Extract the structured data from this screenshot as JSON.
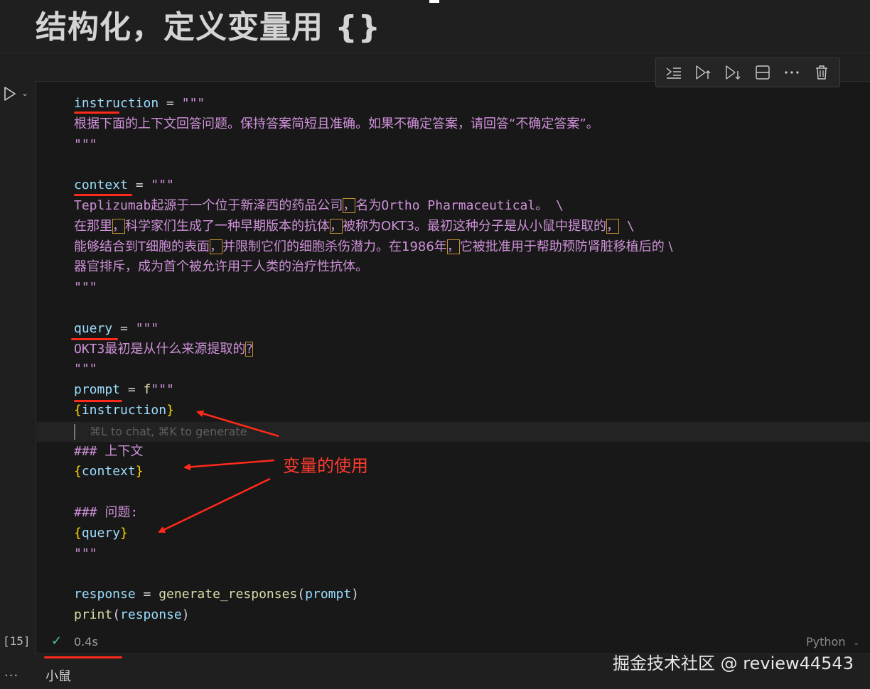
{
  "heading": "结构化，定义变量用 {}",
  "cell": {
    "code_lines": [
      [
        {
          "t": "instruction",
          "c": "var"
        },
        {
          "t": " = ",
          "c": "op"
        },
        {
          "t": "\"\"\"",
          "c": "str"
        }
      ],
      [
        {
          "t": "根据下面的上下文回答问题。保持答案简短且准确。如果不确定答案，请回答“不确定答案”。",
          "c": "str cn"
        }
      ],
      [
        {
          "t": "\"\"\"",
          "c": "str"
        }
      ],
      [],
      [
        {
          "t": "context",
          "c": "var"
        },
        {
          "t": " = ",
          "c": "op"
        },
        {
          "t": "\"\"\"",
          "c": "str"
        }
      ],
      [
        {
          "t": "Teplizumab起源于一个位于新泽西的药品公司",
          "c": "str"
        },
        {
          "t": "，",
          "c": "str box"
        },
        {
          "t": "名为Ortho Pharmaceutical。 \\",
          "c": "str"
        }
      ],
      [
        {
          "t": "在那里",
          "c": "str cn"
        },
        {
          "t": "，",
          "c": "str box"
        },
        {
          "t": "科学家们生成了一种早期版本的抗体",
          "c": "str cn"
        },
        {
          "t": "，",
          "c": "str box"
        },
        {
          "t": "被称为OKT3。最初这种分子是从小鼠中提取的",
          "c": "str cn"
        },
        {
          "t": "，",
          "c": "str box"
        },
        {
          "t": " \\",
          "c": "str"
        }
      ],
      [
        {
          "t": "能够结合到T细胞的表面",
          "c": "str cn"
        },
        {
          "t": "，",
          "c": "str box"
        },
        {
          "t": "并限制它们的细胞杀伤潜力。在1986年",
          "c": "str cn"
        },
        {
          "t": "，",
          "c": "str box"
        },
        {
          "t": "它被批准用于帮助预防肾脏移植后的 \\",
          "c": "str cn"
        }
      ],
      [
        {
          "t": "器官排斥，成为首个被允许用于人类的治疗性抗体。",
          "c": "str cn"
        }
      ],
      [
        {
          "t": "\"\"\"",
          "c": "str"
        }
      ],
      [],
      [
        {
          "t": "query",
          "c": "var"
        },
        {
          "t": " = ",
          "c": "op"
        },
        {
          "t": "\"\"\"",
          "c": "str"
        }
      ],
      [
        {
          "t": "OKT3最初是从什么来源提取的",
          "c": "str"
        },
        {
          "t": "?",
          "c": "str box"
        }
      ],
      [
        {
          "t": "\"\"\"",
          "c": "str"
        }
      ],
      [
        {
          "t": "prompt",
          "c": "var"
        },
        {
          "t": " = ",
          "c": "op"
        },
        {
          "t": "f",
          "c": "fun"
        },
        {
          "t": "\"\"\"",
          "c": "str"
        }
      ],
      [
        {
          "t": "{",
          "c": "brace"
        },
        {
          "t": "instruction",
          "c": "var"
        },
        {
          "t": "}",
          "c": "brace"
        }
      ],
      [],
      [
        {
          "t": "### 上下文",
          "c": "str"
        }
      ],
      [
        {
          "t": "{",
          "c": "brace"
        },
        {
          "t": "context",
          "c": "var"
        },
        {
          "t": "}",
          "c": "brace"
        }
      ],
      [],
      [
        {
          "t": "### 问题:",
          "c": "str"
        }
      ],
      [
        {
          "t": "{",
          "c": "brace"
        },
        {
          "t": "query",
          "c": "var"
        },
        {
          "t": "}",
          "c": "brace"
        }
      ],
      [
        {
          "t": "\"\"\"",
          "c": "str"
        }
      ],
      [],
      [
        {
          "t": "response",
          "c": "var"
        },
        {
          "t": " = ",
          "c": "op"
        },
        {
          "t": "generate_responses",
          "c": "fun"
        },
        {
          "t": "(",
          "c": "op"
        },
        {
          "t": "prompt",
          "c": "var"
        },
        {
          "t": ")",
          "c": "op"
        }
      ],
      [
        {
          "t": "print",
          "c": "fun"
        },
        {
          "t": "(",
          "c": "op"
        },
        {
          "t": "response",
          "c": "var"
        },
        {
          "t": ")",
          "c": "op"
        }
      ]
    ],
    "inline_hint": "⌘L to chat, ⌘K to generate",
    "annotation": "变量的使用",
    "execution_count": "[15]",
    "execution_time": "0.4s",
    "language": "Python"
  },
  "toolbar": {
    "icons": [
      "run-by-line-icon",
      "run-above-icon",
      "run-below-icon",
      "split-cell-icon",
      "more-icon",
      "delete-icon"
    ]
  },
  "output": {
    "more": "...",
    "text": "小鼠"
  },
  "watermark": "掘金技术社区 @ review44543",
  "colors": {
    "background": "#1f1f1f",
    "cell_background": "#181818",
    "variable": "#9cdcfe",
    "string": "#ce91d8",
    "function": "#dcdcaa",
    "brace": "#ffd700",
    "annotation_red": "#ff2a1a",
    "success_green": "#4ec98c"
  }
}
